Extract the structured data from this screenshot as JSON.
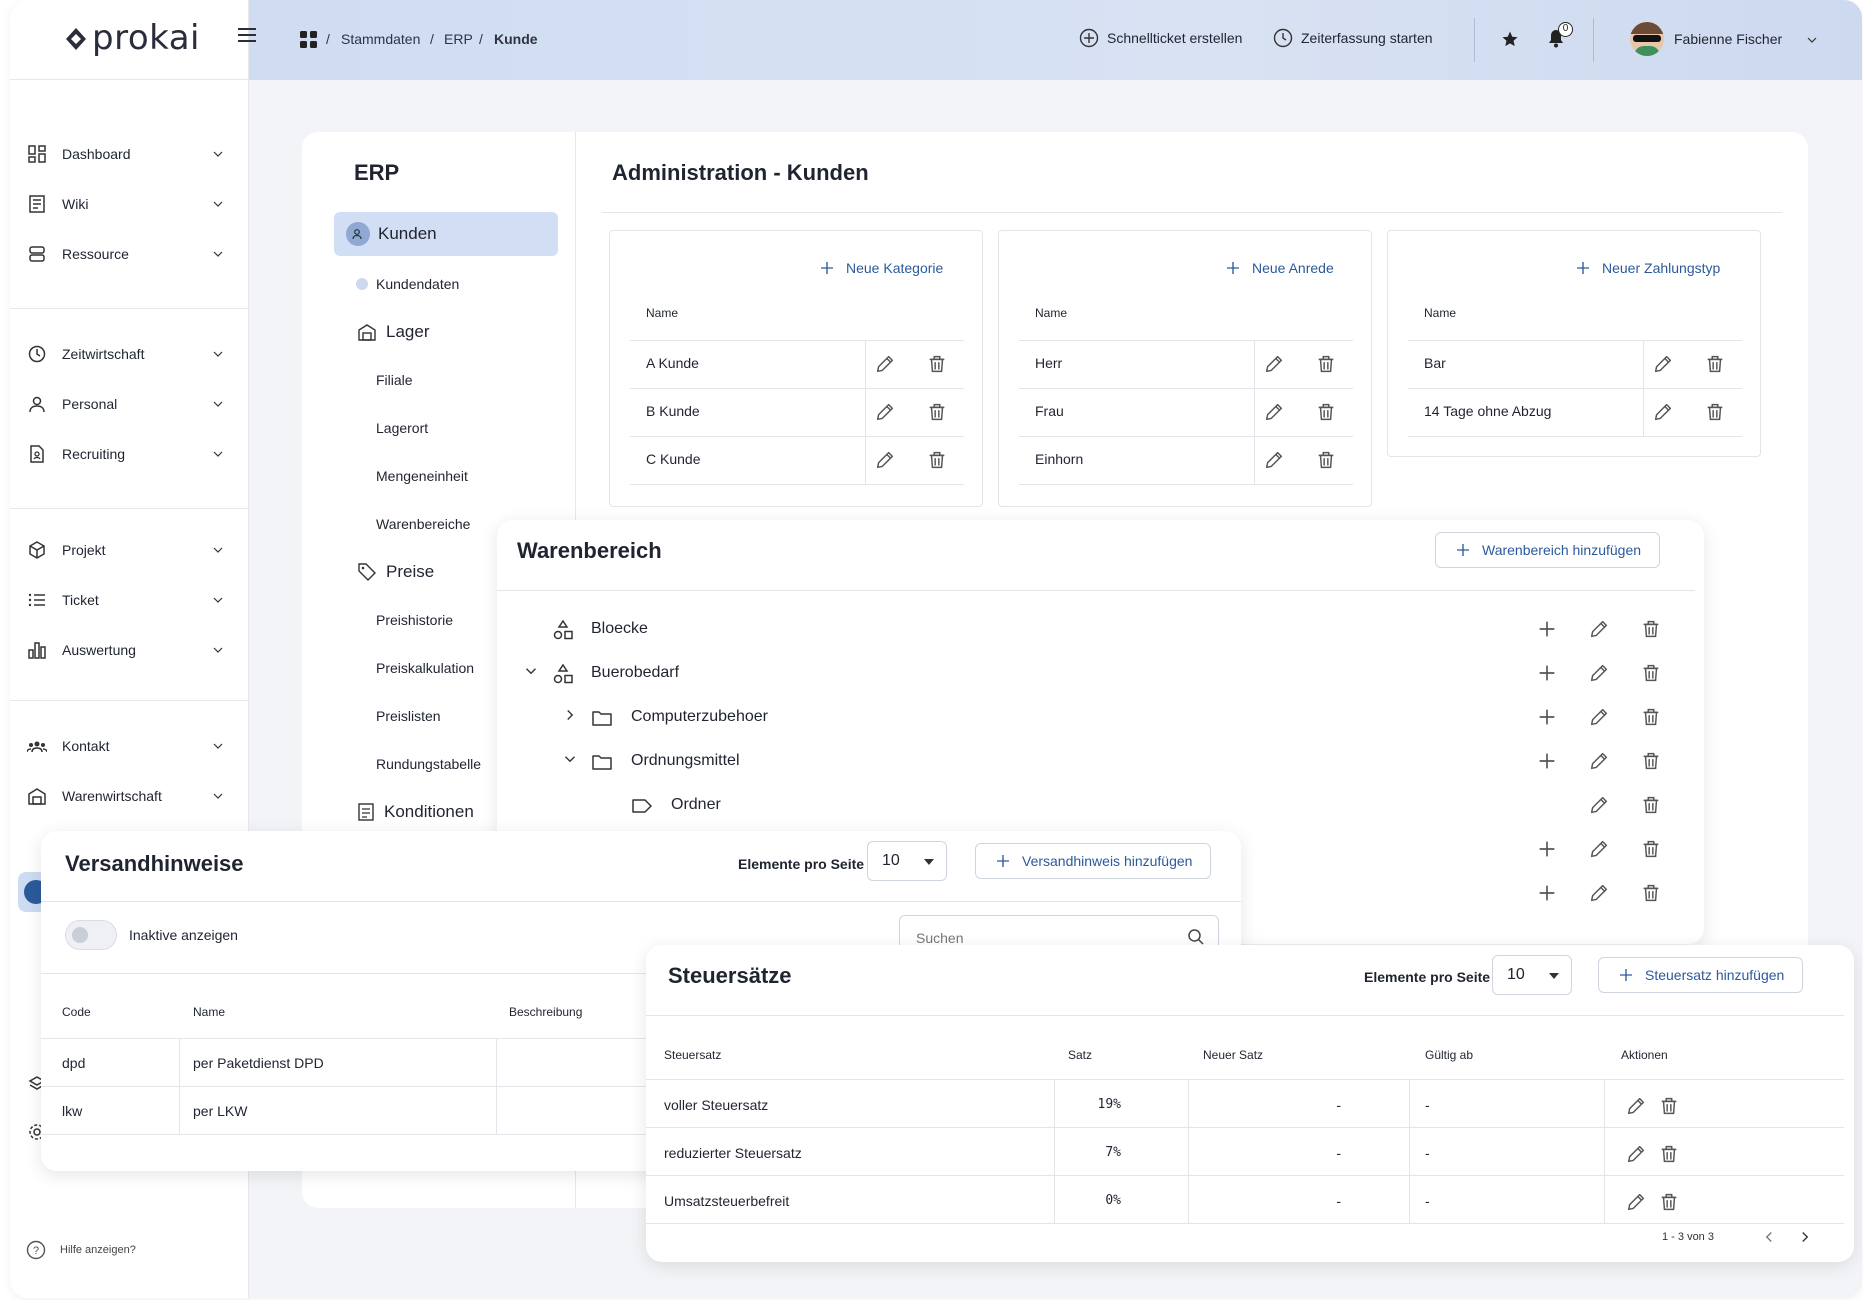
{
  "app": {
    "logo": "prokai"
  },
  "topbar": {
    "breadcrumb": [
      "Stammdaten",
      "ERP",
      "Kunde"
    ],
    "quick_ticket": "Schnellticket erstellen",
    "time_tracking": "Zeiterfassung starten",
    "notification_count": "0",
    "user_name": "Fabienne Fischer"
  },
  "sidebar": {
    "items": [
      {
        "label": "Dashboard",
        "icon": "dashboard-icon"
      },
      {
        "label": "Wiki",
        "icon": "wiki-icon"
      },
      {
        "label": "Ressource",
        "icon": "resource-icon"
      },
      {
        "label": "Zeitwirtschaft",
        "icon": "clock-icon"
      },
      {
        "label": "Personal",
        "icon": "person-icon"
      },
      {
        "label": "Recruiting",
        "icon": "document-icon"
      },
      {
        "label": "Projekt",
        "icon": "cube-icon"
      },
      {
        "label": "Ticket",
        "icon": "list-icon"
      },
      {
        "label": "Auswertung",
        "icon": "chart-icon"
      },
      {
        "label": "Kontakt",
        "icon": "contacts-icon"
      },
      {
        "label": "Warenwirtschaft",
        "icon": "warehouse-icon"
      }
    ],
    "help": "Hilfe anzeigen?"
  },
  "erp_nav": {
    "title": "ERP",
    "kunden": "Kunden",
    "kundendaten": "Kundendaten",
    "lager": "Lager",
    "lager_items": [
      "Filiale",
      "Lagerort",
      "Mengeneinheit",
      "Warenbereiche"
    ],
    "preise": "Preise",
    "preise_items": [
      "Preishistorie",
      "Preiskalkulation",
      "Preislisten",
      "Rundungstabelle"
    ],
    "konditionen": "Konditionen"
  },
  "admin": {
    "title": "Administration - Kunden",
    "kategorie": {
      "add": "Neue Kategorie",
      "header": "Name",
      "rows": [
        "A Kunde",
        "B Kunde",
        "C Kunde"
      ]
    },
    "anrede": {
      "add": "Neue Anrede",
      "header": "Name",
      "rows": [
        "Herr",
        "Frau",
        "Einhorn"
      ]
    },
    "zahlungstyp": {
      "add": "Neuer Zahlungstyp",
      "header": "Name",
      "rows": [
        "Bar",
        "14 Tage ohne Abzug"
      ]
    }
  },
  "warenbereich": {
    "title": "Warenbereich",
    "add": "Warenbereich hinzufügen",
    "nodes": [
      "Bloecke",
      "Buerobedarf",
      "Computerzubehoer",
      "Ordnungsmittel",
      "Ordner"
    ]
  },
  "versand": {
    "title": "Versandhinweise",
    "per_page_label": "Elemente pro Seite",
    "per_page": "10",
    "add": "Versandhinweis hinzufügen",
    "toggle_label": "Inaktive anzeigen",
    "search_placeholder": "Suchen",
    "headers": [
      "Code",
      "Name",
      "Beschreibung"
    ],
    "rows": [
      {
        "code": "dpd",
        "name": "per Paketdienst DPD"
      },
      {
        "code": "lkw",
        "name": "per LKW"
      }
    ]
  },
  "steuer": {
    "title": "Steuersätze",
    "per_page_label": "Elemente pro Seite",
    "per_page": "10",
    "add": "Steuersatz hinzufügen",
    "headers": [
      "Steuersatz",
      "Satz",
      "Neuer Satz",
      "Gültig ab",
      "Aktionen"
    ],
    "rows": [
      {
        "name": "voller Steuersatz",
        "satz": "19%",
        "neu": "-",
        "ab": "-"
      },
      {
        "name": "reduzierter Steuersatz",
        "satz": "7%",
        "neu": "-",
        "ab": "-"
      },
      {
        "name": "Umsatzsteuerbefreit",
        "satz": "0%",
        "neu": "-",
        "ab": "-"
      }
    ],
    "pagination": "1 - 3 von 3"
  }
}
